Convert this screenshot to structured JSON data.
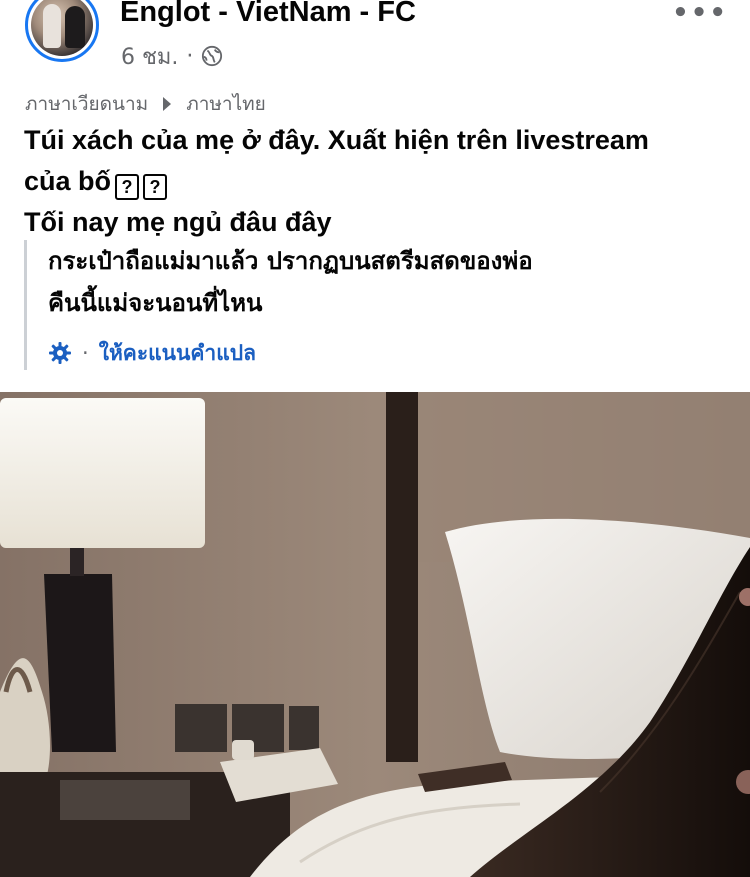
{
  "header": {
    "page_name": "Englot - VietNam - FC",
    "time": "6 ชม.",
    "separator": "·",
    "more": "•••"
  },
  "translation_bar": {
    "source_language": "ภาษาเวียดนาม",
    "target_language": "ภาษาไทย"
  },
  "post": {
    "line1": "Túi xách của mẹ ở đây. Xuất hiện trên livestream",
    "line2": "của bố",
    "qbox": "?",
    "line3": "Tối nay mẹ ngủ đâu đây"
  },
  "translation": {
    "line1": "กระเป๋าถือแม่มาแล้ว ปรากฏบนสตรีมสดของพ่อ",
    "line2": "คืนนี้แม่จะนอนที่ไหน",
    "separator": "·",
    "rate_label": "ให้คะแนนคำแปล"
  },
  "colors": {
    "accent": "#1877f2",
    "link": "#1b5fc1",
    "muted": "#65676b"
  }
}
